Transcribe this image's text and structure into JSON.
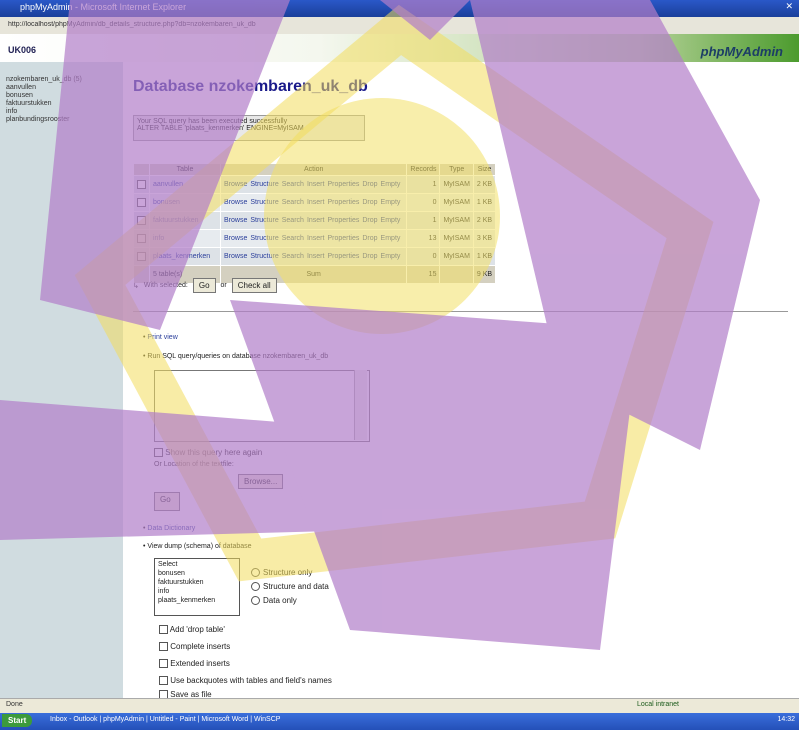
{
  "window": {
    "title": "phpMyAdmin - Microsoft Internet Explorer"
  },
  "address": {
    "url": "http://localhost/phpMyAdmin/db_details_structure.php?db=nzokembaren_uk_db"
  },
  "pma": {
    "server": "UK006",
    "logo": "phpMyAdmin"
  },
  "sidebar": {
    "items": [
      {
        "label": "nzokembaren_uk_db (5)"
      },
      {
        "label": "aanvullen"
      },
      {
        "label": "bonusen"
      },
      {
        "label": "faktuurstukken"
      },
      {
        "label": "info"
      },
      {
        "label": "planbundingsrooster"
      }
    ]
  },
  "page": {
    "title": "Database nzokembaren_uk_db",
    "message_line1": "Your SQL query has been executed successfully",
    "message_line2": "ALTER TABLE 'plaats_kenmerken' ENGINE=MyISAM"
  },
  "table": {
    "headers": [
      "",
      "Table",
      "Action",
      "Records",
      "Type",
      "Size"
    ],
    "actions": [
      "Browse",
      "Structure",
      "Search",
      "Insert",
      "Properties",
      "Drop",
      "Empty"
    ],
    "rows": [
      {
        "name": "aanvullen",
        "records": "1",
        "type": "MyISAM",
        "size": "2 KB"
      },
      {
        "name": "bonusen",
        "records": "0",
        "type": "MyISAM",
        "size": "1 KB"
      },
      {
        "name": "faktuurstukken",
        "records": "1",
        "type": "MyISAM",
        "size": "2 KB"
      },
      {
        "name": "info",
        "records": "13",
        "type": "MyISAM",
        "size": "3 KB"
      },
      {
        "name": "plaats_kenmerken",
        "records": "0",
        "type": "MyISAM",
        "size": "1 KB"
      }
    ],
    "sum": {
      "name": "5 table(s)",
      "label": "Sum",
      "records": "15",
      "size": "9 KB"
    }
  },
  "withsel": {
    "label": "With selected:",
    "go_label": "Go",
    "or_label": "or",
    "check_label": "Check all"
  },
  "sections": {
    "print": "Print view",
    "run_sql": "Run SQL query/queries on database nzokembaren_uk_db",
    "show_query": "Show this query here again",
    "location_text": "Or Location of the textfile:",
    "browse_label": "Browse...",
    "data_dict": "Data Dictionary",
    "export": "View dump (schema) of database"
  },
  "export_tables": [
    "Select",
    "bonusen",
    "faktuurstukken",
    "info",
    "plaats_kenmerken"
  ],
  "export_options": {
    "radios": [
      "Structure only",
      "Structure and data",
      "Data only"
    ],
    "checks": [
      "Add 'drop table'",
      "Complete inserts",
      "Extended inserts",
      "Use backquotes with tables and field's names",
      "Save as file"
    ]
  },
  "taskbar": {
    "status": "Done",
    "zone": "Local intranet",
    "start": "Start",
    "tasks": "Inbox - Outlook | phpMyAdmin | Untitled - Paint | Microsoft Word | WinSCP",
    "clock": "14:32"
  }
}
